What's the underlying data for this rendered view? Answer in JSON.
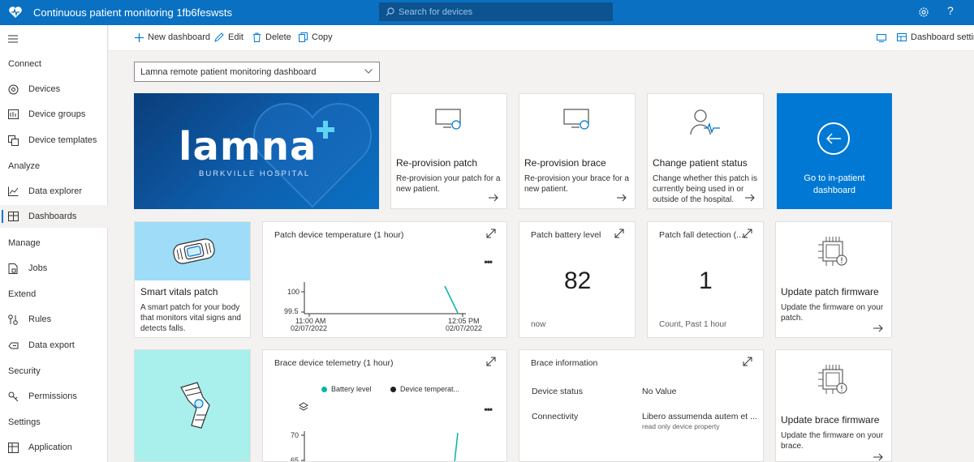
{
  "header": {
    "app_title": "Continuous patient monitoring 1fb6feswsts",
    "search_placeholder": "Search for devices",
    "help_label": "?"
  },
  "sidebar": {
    "sections": [
      {
        "label": "Connect"
      },
      {
        "label": "Analyze"
      },
      {
        "label": "Manage"
      },
      {
        "label": "Extend"
      },
      {
        "label": "Security"
      },
      {
        "label": "Settings"
      }
    ],
    "items": [
      {
        "label": "Devices"
      },
      {
        "label": "Device groups"
      },
      {
        "label": "Device templates"
      },
      {
        "label": "Data explorer"
      },
      {
        "label": "Dashboards"
      },
      {
        "label": "Jobs"
      },
      {
        "label": "Rules"
      },
      {
        "label": "Data export"
      },
      {
        "label": "Permissions"
      },
      {
        "label": "Application"
      }
    ]
  },
  "toolbar": {
    "new_dashboard": "New dashboard",
    "edit": "Edit",
    "delete": "Delete",
    "copy": "Copy",
    "dashboard_settings": "Dashboard settings"
  },
  "dashboard_select": {
    "value": "Lamna remote patient monitoring dashboard"
  },
  "branding": {
    "logo_text": "lamna",
    "logo_sub": "BURKVILLE HOSPITAL"
  },
  "action_tiles": [
    {
      "title": "Re-provision patch",
      "desc": "Re-provision your patch for a new patient."
    },
    {
      "title": "Re-provision brace",
      "desc": "Re-provision your brace for a new patient."
    },
    {
      "title": "Change patient status",
      "desc": "Change whether this patch is currently being used in or outside of the hospital."
    }
  ],
  "inpatient": {
    "label": "Go to in-patient dashboard"
  },
  "smart_patch": {
    "title": "Smart vitals patch",
    "desc": "A smart patch for your body that monitors vital signs and detects falls."
  },
  "temp_chart": {
    "title": "Patch device temperature (1 hour)",
    "menu": "•••",
    "y_ticks": [
      "100",
      "99.5"
    ],
    "x_ticks": [
      {
        "time": "11:00 AM",
        "date": "02/07/2022"
      },
      {
        "time": "12:05 PM",
        "date": "02/07/2022"
      }
    ]
  },
  "battery": {
    "title": "Patch battery level",
    "value": "82",
    "sub": "now"
  },
  "fall": {
    "title": "Patch fall detection (...",
    "value": "1",
    "sub": "Count, Past 1 hour"
  },
  "patch_firmware": {
    "title": "Update patch firmware",
    "desc": "Update the firmware on your patch."
  },
  "brace_chart": {
    "title": "Brace device telemetry (1 hour)",
    "menu": "•••",
    "legend": [
      "Battery level",
      "Device temperat..."
    ],
    "y_ticks": [
      "70",
      "65"
    ]
  },
  "brace_info": {
    "title": "Brace information",
    "rows": [
      {
        "label": "Device status",
        "value": "No Value",
        "sub": ""
      },
      {
        "label": "Connectivity",
        "value": "Libero assumenda autem et ...",
        "sub": "read only device property"
      }
    ]
  },
  "brace_firmware": {
    "title": "Update brace firmware",
    "desc": "Update the firmware on your brace."
  },
  "colors": {
    "brand": "#0a70c2",
    "accent": "#0078d4",
    "teal_series": "#00b7a8",
    "dark_series": "#201f1e",
    "patch_bg": "#9fdcf8"
  }
}
